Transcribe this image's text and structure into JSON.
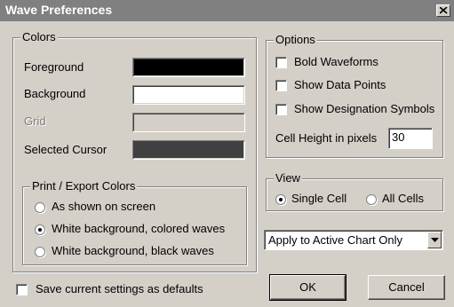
{
  "window": {
    "title": "Wave Preferences"
  },
  "colors": {
    "legend": "Colors",
    "items": [
      {
        "label": "Foreground",
        "swatch": "#000000"
      },
      {
        "label": "Background",
        "swatch": "#ffffff"
      },
      {
        "label": "Grid",
        "swatch": "#d4d0c8"
      },
      {
        "label": "Selected Cursor",
        "swatch": "#404040"
      }
    ]
  },
  "print_export": {
    "legend": "Print / Export Colors",
    "options": [
      {
        "label": "As shown on screen",
        "selected": false
      },
      {
        "label": "White background, colored waves",
        "selected": true
      },
      {
        "label": "White background, black waves",
        "selected": false
      }
    ]
  },
  "options": {
    "legend": "Options",
    "checkboxes": [
      {
        "label": "Bold Waveforms",
        "checked": false
      },
      {
        "label": "Show Data Points",
        "checked": false
      },
      {
        "label": "Show Designation Symbols",
        "checked": false
      }
    ],
    "cell_height_label": "Cell Height in pixels",
    "cell_height_value": "30"
  },
  "view": {
    "legend": "View",
    "options": [
      {
        "label": "Single Cell",
        "selected": true
      },
      {
        "label": "All Cells",
        "selected": false
      }
    ]
  },
  "apply_scope": {
    "selected": "Apply to Active Chart Only"
  },
  "save_defaults": {
    "label": "Save current settings as defaults",
    "checked": false
  },
  "buttons": {
    "ok": "OK",
    "cancel": "Cancel"
  }
}
